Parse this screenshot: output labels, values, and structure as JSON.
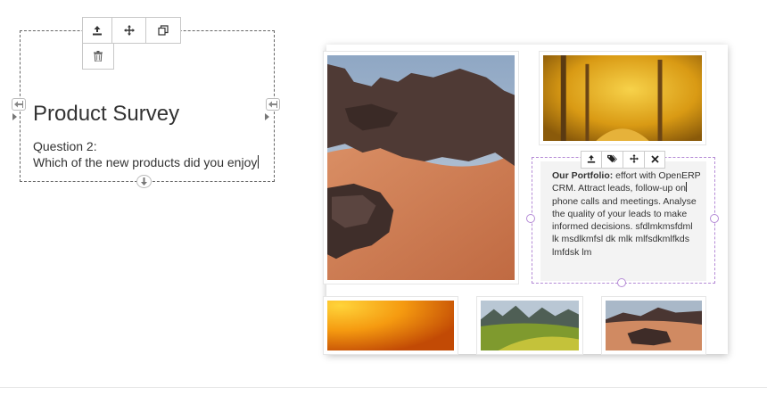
{
  "survey": {
    "title": "Product Survey",
    "question_label": "Question 2:",
    "question_text": "Which of the new products did you enjoy"
  },
  "portfolio": {
    "heading": "Our Portfolio:",
    "text_before_caret": " effort with OpenERP CRM. Attract leads, follow-up on",
    "text_after_caret": "phone calls and meetings. Analyse the quality of your leads to make informed decisions. sfdlmkmsfdml lk msdlkmfsl dk mlk mlfsdkmlfkds lmfdsk lm"
  },
  "icons": {
    "snippet_toolbar": [
      "upload-icon",
      "move-icon",
      "clone-icon",
      "trash-icon"
    ],
    "text_toolbar": [
      "upload-icon",
      "tags-icon",
      "move-icon",
      "close-icon"
    ]
  },
  "colors": {
    "dashed_border": "#666666",
    "text_box_border": "#b58bd6",
    "text_box_bg": "#f3f3f3"
  }
}
